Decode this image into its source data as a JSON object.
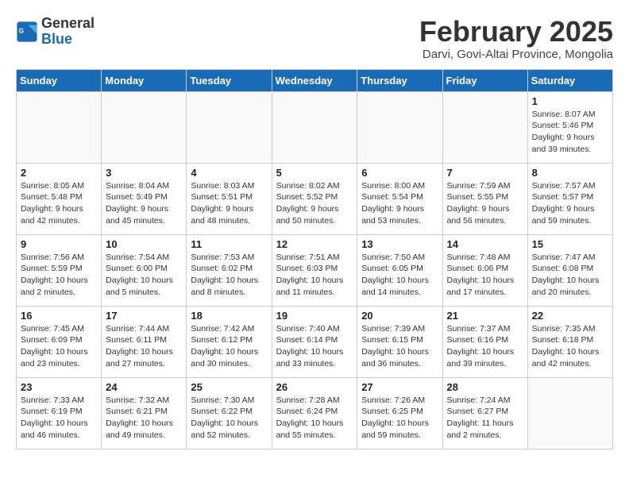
{
  "header": {
    "logo_line1": "General",
    "logo_line2": "Blue",
    "month_title": "February 2025",
    "location": "Darvi, Govi-Altai Province, Mongolia"
  },
  "days_of_week": [
    "Sunday",
    "Monday",
    "Tuesday",
    "Wednesday",
    "Thursday",
    "Friday",
    "Saturday"
  ],
  "weeks": [
    [
      {
        "day": "",
        "info": ""
      },
      {
        "day": "",
        "info": ""
      },
      {
        "day": "",
        "info": ""
      },
      {
        "day": "",
        "info": ""
      },
      {
        "day": "",
        "info": ""
      },
      {
        "day": "",
        "info": ""
      },
      {
        "day": "1",
        "info": "Sunrise: 8:07 AM\nSunset: 5:46 PM\nDaylight: 9 hours and 39 minutes."
      }
    ],
    [
      {
        "day": "2",
        "info": "Sunrise: 8:05 AM\nSunset: 5:48 PM\nDaylight: 9 hours and 42 minutes."
      },
      {
        "day": "3",
        "info": "Sunrise: 8:04 AM\nSunset: 5:49 PM\nDaylight: 9 hours and 45 minutes."
      },
      {
        "day": "4",
        "info": "Sunrise: 8:03 AM\nSunset: 5:51 PM\nDaylight: 9 hours and 48 minutes."
      },
      {
        "day": "5",
        "info": "Sunrise: 8:02 AM\nSunset: 5:52 PM\nDaylight: 9 hours and 50 minutes."
      },
      {
        "day": "6",
        "info": "Sunrise: 8:00 AM\nSunset: 5:54 PM\nDaylight: 9 hours and 53 minutes."
      },
      {
        "day": "7",
        "info": "Sunrise: 7:59 AM\nSunset: 5:55 PM\nDaylight: 9 hours and 56 minutes."
      },
      {
        "day": "8",
        "info": "Sunrise: 7:57 AM\nSunset: 5:57 PM\nDaylight: 9 hours and 59 minutes."
      }
    ],
    [
      {
        "day": "9",
        "info": "Sunrise: 7:56 AM\nSunset: 5:59 PM\nDaylight: 10 hours and 2 minutes."
      },
      {
        "day": "10",
        "info": "Sunrise: 7:54 AM\nSunset: 6:00 PM\nDaylight: 10 hours and 5 minutes."
      },
      {
        "day": "11",
        "info": "Sunrise: 7:53 AM\nSunset: 6:02 PM\nDaylight: 10 hours and 8 minutes."
      },
      {
        "day": "12",
        "info": "Sunrise: 7:51 AM\nSunset: 6:03 PM\nDaylight: 10 hours and 11 minutes."
      },
      {
        "day": "13",
        "info": "Sunrise: 7:50 AM\nSunset: 6:05 PM\nDaylight: 10 hours and 14 minutes."
      },
      {
        "day": "14",
        "info": "Sunrise: 7:48 AM\nSunset: 6:06 PM\nDaylight: 10 hours and 17 minutes."
      },
      {
        "day": "15",
        "info": "Sunrise: 7:47 AM\nSunset: 6:08 PM\nDaylight: 10 hours and 20 minutes."
      }
    ],
    [
      {
        "day": "16",
        "info": "Sunrise: 7:45 AM\nSunset: 6:09 PM\nDaylight: 10 hours and 23 minutes."
      },
      {
        "day": "17",
        "info": "Sunrise: 7:44 AM\nSunset: 6:11 PM\nDaylight: 10 hours and 27 minutes."
      },
      {
        "day": "18",
        "info": "Sunrise: 7:42 AM\nSunset: 6:12 PM\nDaylight: 10 hours and 30 minutes."
      },
      {
        "day": "19",
        "info": "Sunrise: 7:40 AM\nSunset: 6:14 PM\nDaylight: 10 hours and 33 minutes."
      },
      {
        "day": "20",
        "info": "Sunrise: 7:39 AM\nSunset: 6:15 PM\nDaylight: 10 hours and 36 minutes."
      },
      {
        "day": "21",
        "info": "Sunrise: 7:37 AM\nSunset: 6:16 PM\nDaylight: 10 hours and 39 minutes."
      },
      {
        "day": "22",
        "info": "Sunrise: 7:35 AM\nSunset: 6:18 PM\nDaylight: 10 hours and 42 minutes."
      }
    ],
    [
      {
        "day": "23",
        "info": "Sunrise: 7:33 AM\nSunset: 6:19 PM\nDaylight: 10 hours and 46 minutes."
      },
      {
        "day": "24",
        "info": "Sunrise: 7:32 AM\nSunset: 6:21 PM\nDaylight: 10 hours and 49 minutes."
      },
      {
        "day": "25",
        "info": "Sunrise: 7:30 AM\nSunset: 6:22 PM\nDaylight: 10 hours and 52 minutes."
      },
      {
        "day": "26",
        "info": "Sunrise: 7:28 AM\nSunset: 6:24 PM\nDaylight: 10 hours and 55 minutes."
      },
      {
        "day": "27",
        "info": "Sunrise: 7:26 AM\nSunset: 6:25 PM\nDaylight: 10 hours and 59 minutes."
      },
      {
        "day": "28",
        "info": "Sunrise: 7:24 AM\nSunset: 6:27 PM\nDaylight: 11 hours and 2 minutes."
      },
      {
        "day": "",
        "info": ""
      }
    ]
  ]
}
